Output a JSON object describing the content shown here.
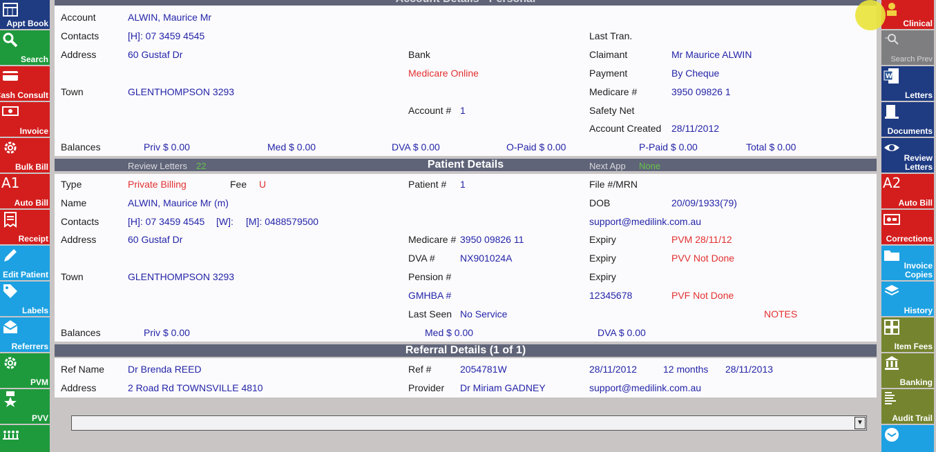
{
  "left_sidebar": [
    {
      "label": "Appt Book",
      "color": "#1f3b82"
    },
    {
      "label": "Search",
      "color": "#1e9a3c"
    },
    {
      "label": "Cash Consult",
      "color": "#d41e1e"
    },
    {
      "label": "Invoice",
      "color": "#d41e1e"
    },
    {
      "label": "Bulk Bill",
      "color": "#d41e1e"
    },
    {
      "label": "Auto Bill",
      "glyph": "A1",
      "color": "#d41e1e"
    },
    {
      "label": "Receipt",
      "color": "#d41e1e"
    },
    {
      "label": "Edit Patient",
      "color": "#1da1e2"
    },
    {
      "label": "Labels",
      "color": "#1da1e2"
    },
    {
      "label": "Referrers",
      "color": "#1da1e2"
    },
    {
      "label": "PVM",
      "color": "#1e9a3c"
    },
    {
      "label": "PVV",
      "color": "#1e9a3c"
    }
  ],
  "right_sidebar": [
    {
      "label": "Clinical",
      "color": "#d41e1e"
    },
    {
      "label": "Search Prev",
      "color": "#7e7e80"
    },
    {
      "label": "Letters",
      "color": "#1f3b82"
    },
    {
      "label": "Documents",
      "color": "#1f3b82"
    },
    {
      "label": "Review Letters",
      "color": "#1f3b82"
    },
    {
      "label": "Auto Bill",
      "glyph": "A2",
      "color": "#d41e1e"
    },
    {
      "label": "Corrections",
      "color": "#d41e1e"
    },
    {
      "label": "Invoice Copies",
      "color": "#1da1e2"
    },
    {
      "label": "History",
      "color": "#1da1e2"
    },
    {
      "label": "Item Fees",
      "color": "#75842f"
    },
    {
      "label": "Banking",
      "color": "#75842f"
    },
    {
      "label": "Audit Trail",
      "color": "#75842f"
    }
  ],
  "account": {
    "header": "Account Details - Personal",
    "account_label": "Account",
    "account_value": "ALWIN, Maurice Mr",
    "contacts_label": "Contacts",
    "contacts_value": "[H]: 07 3459 4545",
    "address_label": "Address",
    "address_value": "60 Gustaf Dr",
    "town_label": "Town",
    "town_value": "GLENTHOMPSON  3293",
    "bank_label": "Bank",
    "medicare_online": "Medicare Online",
    "account_num_label": "Account #",
    "account_num_value": "1",
    "last_tran_label": "Last Tran.",
    "claimant_label": "Claimant",
    "claimant_value": "Mr Maurice ALWIN",
    "payment_label": "Payment",
    "payment_value": "By Cheque",
    "medicare_label": "Medicare #",
    "medicare_value": "3950 09826 1",
    "safety_net_label": "Safety Net",
    "created_label": "Account Created",
    "created_value": "28/11/2012",
    "balances_label": "Balances",
    "priv": "Priv $ 0.00",
    "med": "Med $ 0.00",
    "dva": "DVA $ 0.00",
    "opaid": "O-Paid $ 0.00",
    "ppaid": "P-Paid $ 0.00",
    "total": "Total $ 0.00"
  },
  "patient": {
    "header": "Patient Details",
    "review_letters_label": "Review Letters",
    "review_letters_count": "22",
    "next_app_label": "Next App",
    "next_app_value": "None",
    "type_label": "Type",
    "type_value": "Private Billing",
    "fee_label": "Fee",
    "fee_value": "U",
    "name_label": "Name",
    "name_value": "ALWIN,  Maurice  Mr  (m)",
    "contacts_label": "Contacts",
    "contacts_h": "[H]: 07 3459 4545",
    "contacts_w": "[W]:",
    "contacts_m": "[M]: 0488579500",
    "address_label": "Address",
    "address_value": "60 Gustaf Dr",
    "town_label": "Town",
    "town_value": "GLENTHOMPSON  3293",
    "balances_label": "Balances",
    "priv": "Priv $ 0.00",
    "med": "Med $ 0.00",
    "dva": "DVA $ 0.00",
    "patient_num_label": "Patient #",
    "patient_num_value": "1",
    "medicare_label": "Medicare #",
    "medicare_value": "3950 09826 11",
    "dva_label": "DVA #",
    "dva_value": "NX901024A",
    "pension_label": "Pension #",
    "fund_label": "GMHBA #",
    "fund_value": "12345678",
    "last_seen_label": "Last Seen",
    "last_seen_value": "No Service",
    "file_label": "File #/MRN",
    "dob_label": "DOB",
    "dob_value": "20/09/1933(79)",
    "email": "support@medilink.com.au",
    "expiry_label": "Expiry",
    "pvm": "PVM 28/11/12",
    "pvv": "PVV Not Done",
    "pvf": "PVF Not Done",
    "notes": "NOTES"
  },
  "referral": {
    "header": "Referral Details (1 of 1)",
    "ref_name_label": "Ref Name",
    "ref_name_value": "Dr Brenda REED",
    "address_label": "Address",
    "address_value": "2 Road Rd  TOWNSVILLE 4810",
    "ref_num_label": "Ref #",
    "ref_num_value": "2054781W",
    "provider_label": "Provider",
    "provider_value": "Dr Miriam GADNEY",
    "date": "28/11/2012",
    "period": "12 months",
    "expiry": "28/11/2013",
    "email": "support@medilink.com.au"
  },
  "combo": {
    "arrow": "▼"
  }
}
